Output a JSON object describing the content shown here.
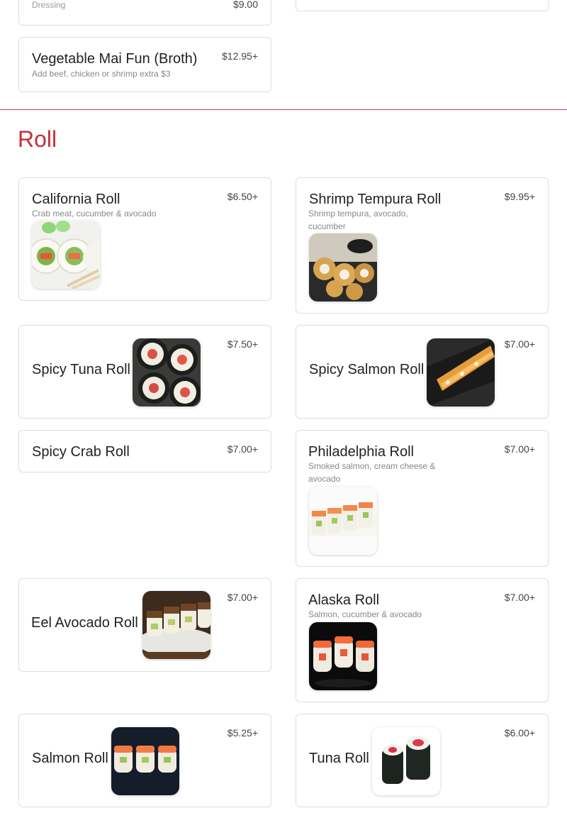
{
  "prev_section": {
    "partial_item": {
      "desc": "Dressing",
      "price": "$9.00"
    },
    "item": {
      "name": "Vegetable Mai Fun (Broth)",
      "price": "$12.95+",
      "desc": "Add beef, chicken or shrimp extra $3"
    }
  },
  "section": {
    "title": "Roll",
    "accent_color": "#c0313a"
  },
  "items": [
    {
      "name": "California Roll",
      "price": "$6.50+",
      "desc": "Crab meat, cucumber & avocado",
      "image": "california-roll-photo"
    },
    {
      "name": "Shrimp Tempura Roll",
      "price": "$9.95+",
      "desc": "Shrimp tempura, avocado, cucumber",
      "image": "shrimp-tempura-roll-photo"
    },
    {
      "name": "Spicy Tuna Roll",
      "price": "$7.50+",
      "desc": "",
      "image": "spicy-tuna-roll-photo"
    },
    {
      "name": "Spicy Salmon Roll",
      "price": "$7.00+",
      "desc": "",
      "image": "spicy-salmon-roll-photo"
    },
    {
      "name": "Spicy Crab Roll",
      "price": "$7.00+",
      "desc": "",
      "image": ""
    },
    {
      "name": "Philadelphia Roll",
      "price": "$7.00+",
      "desc": "Smoked salmon, cream cheese & avocado",
      "image": "philadelphia-roll-photo"
    },
    {
      "name": "Eel Avocado Roll",
      "price": "$7.00+",
      "desc": "",
      "image": "eel-avocado-roll-photo"
    },
    {
      "name": "Alaska Roll",
      "price": "$7.00+",
      "desc": "Salmon, cucumber & avocado",
      "image": "alaska-roll-photo"
    },
    {
      "name": "Salmon Roll",
      "price": "$5.25+",
      "desc": "",
      "image": "salmon-roll-photo"
    },
    {
      "name": "Tuna Roll",
      "price": "$6.00+",
      "desc": "",
      "image": "tuna-roll-photo"
    }
  ]
}
